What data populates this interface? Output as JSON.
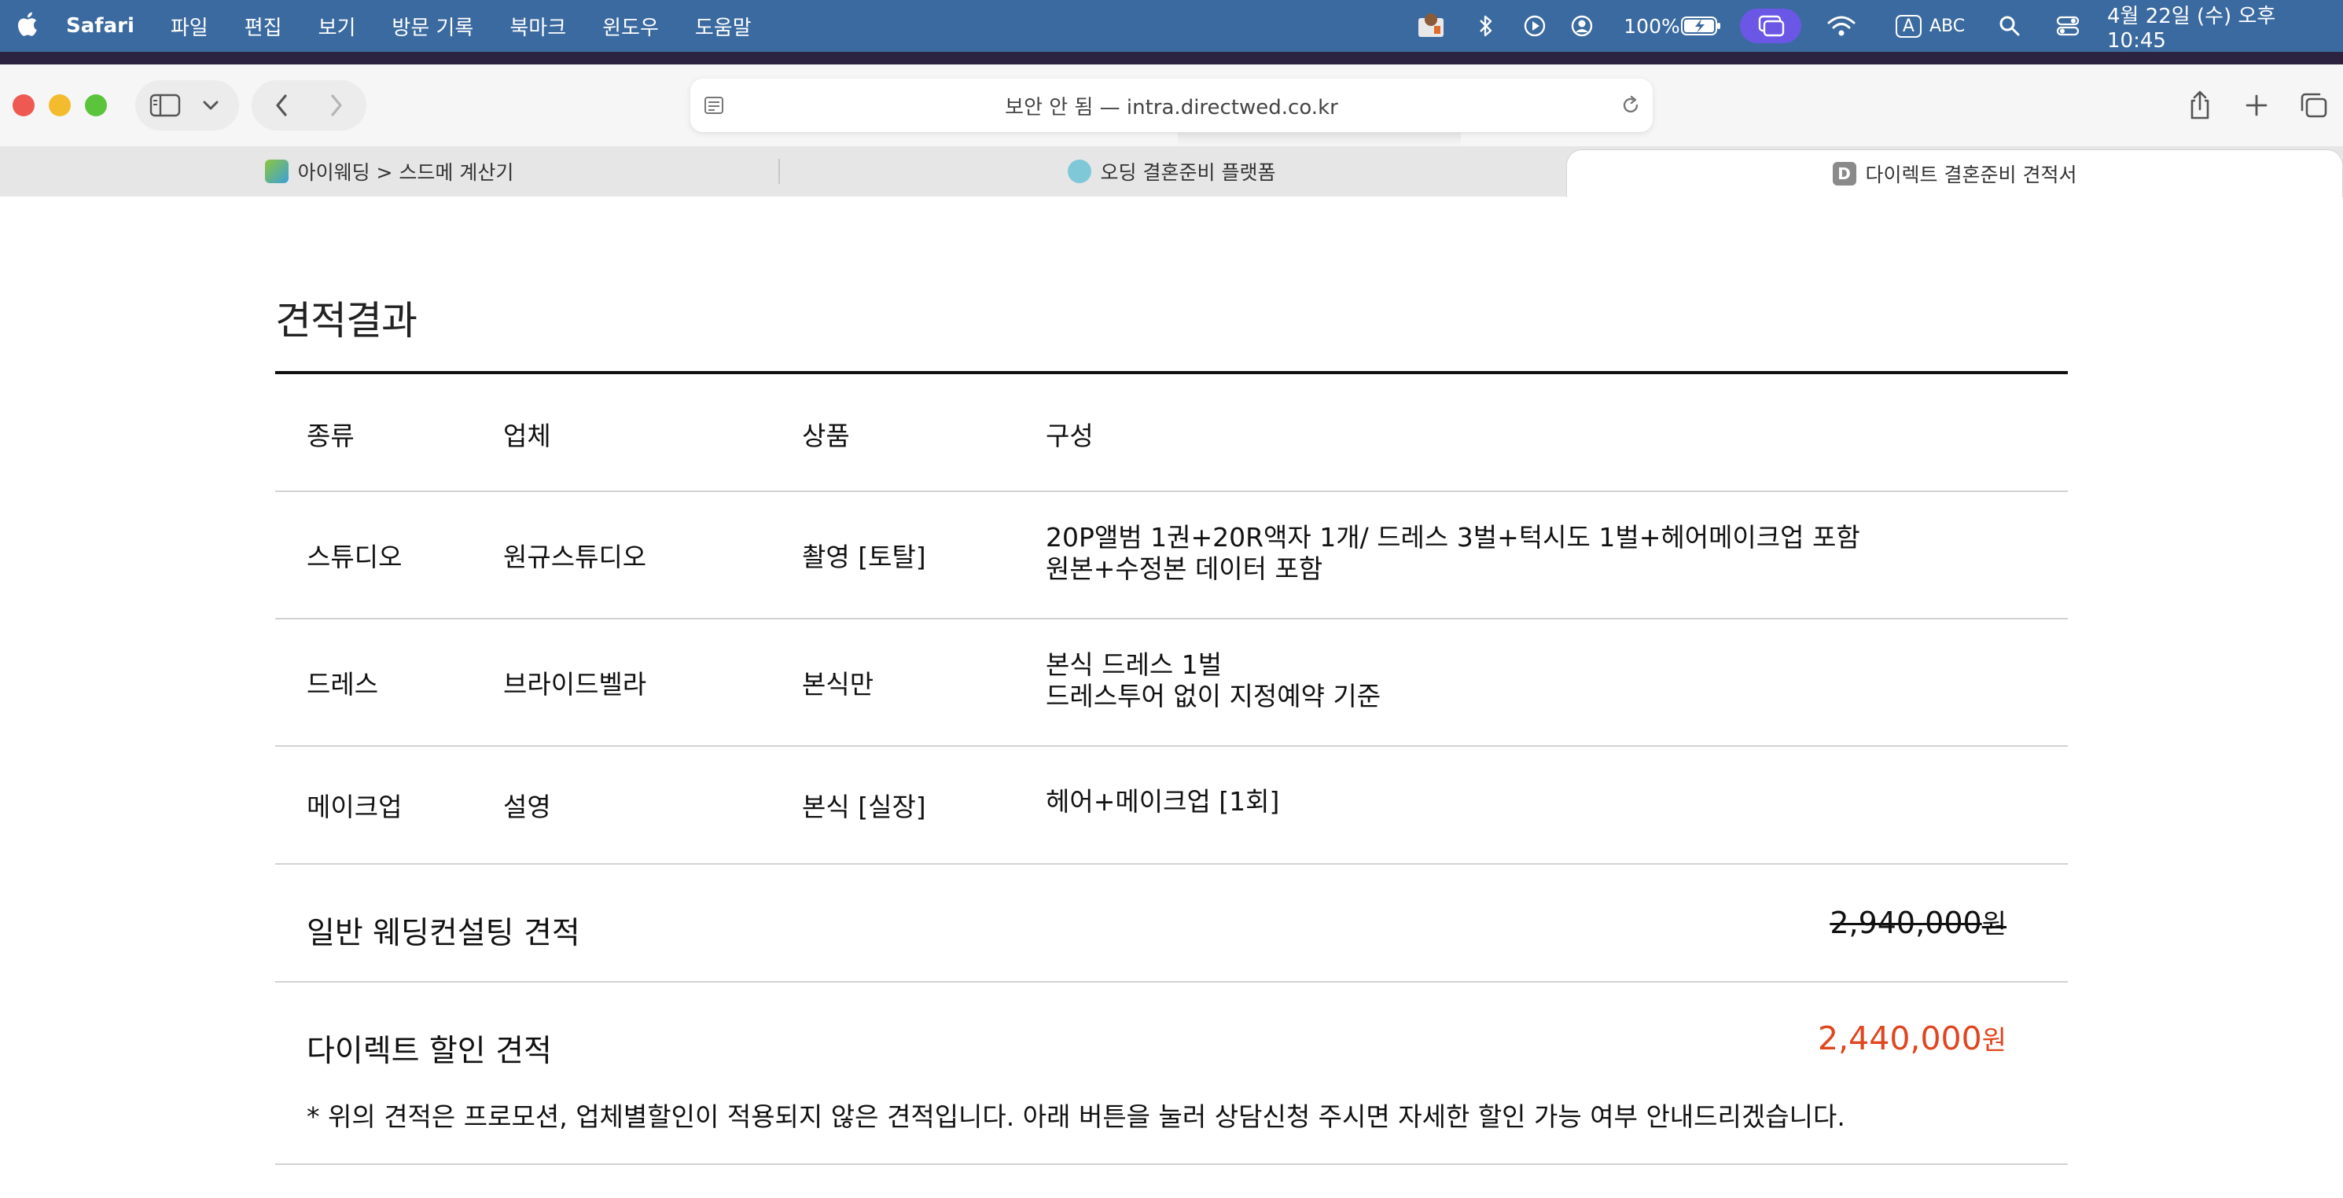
{
  "menubar": {
    "app_name": "Safari",
    "items": [
      "파일",
      "편집",
      "보기",
      "방문 기록",
      "북마크",
      "윈도우",
      "도움말"
    ],
    "battery": "100%",
    "input_source": "ABC",
    "input_badge": "A",
    "datetime": "4월 22일 (수) 오후 10:45"
  },
  "address_bar": {
    "text": "보안 안 됨 — intra.directwed.co.kr"
  },
  "tabs": [
    {
      "label": "아이웨딩 > 스드메 계산기"
    },
    {
      "label": "오딩 결혼준비 플랫폼"
    },
    {
      "label": "다이렉트 결혼준비 견적서",
      "favicon_letter": "D"
    }
  ],
  "page": {
    "title": "견적결과",
    "table": {
      "headers": [
        "종류",
        "업체",
        "상품",
        "구성"
      ],
      "rows": [
        {
          "type": "스튜디오",
          "vendor": "원규스튜디오",
          "product": "촬영 [토탈]",
          "composition": [
            "20P앨범 1권+20R액자 1개/ 드레스 3벌+턱시도 1벌+헤어메이크업 포함",
            "원본+수정본 데이터 포함"
          ]
        },
        {
          "type": "드레스",
          "vendor": "브라이드벨라",
          "product": "본식만",
          "composition": [
            "본식 드레스 1벌",
            "드레스투어 없이 지정예약 기준"
          ]
        },
        {
          "type": "메이크업",
          "vendor": "설영",
          "product": "본식 [실장]",
          "composition": [
            "헤어+메이크업 [1회]"
          ]
        }
      ]
    },
    "regular_estimate": {
      "label": "일반 웨딩컨설팅 견적",
      "amount": "2,940,000",
      "unit": "원"
    },
    "direct_estimate": {
      "label": "다이렉트 할인 견적",
      "amount": "2,440,000",
      "unit": "원"
    },
    "note": "* 위의 견적은 프로모션, 업체별할인이 적용되지 않은 견적입니다. 아래 버튼을 눌러 상담신청 주시면 자세한 할인 가능 여부 안내드리겠습니다."
  },
  "colors": {
    "menubar": "#3b6aa0",
    "discount": "#e0461f",
    "screen_mirror": "#6b57e6"
  }
}
